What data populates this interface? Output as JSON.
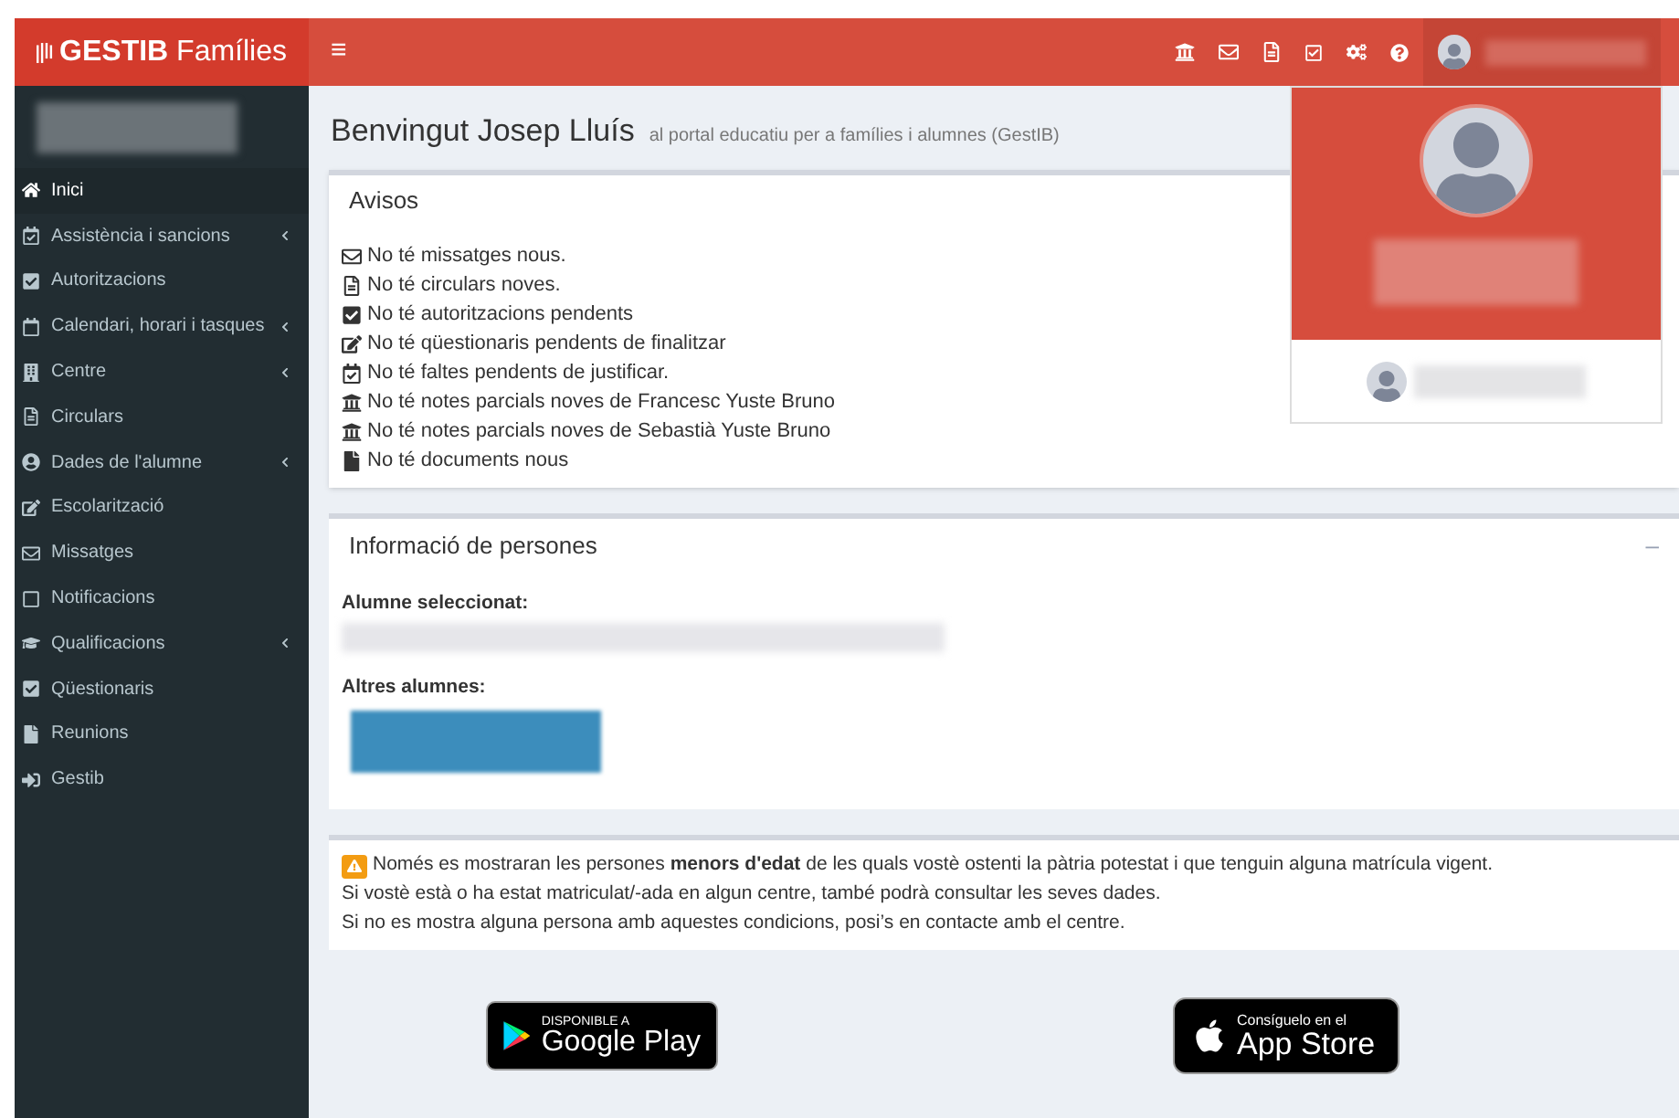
{
  "brand": {
    "bold": "GESTIB",
    "light": "Famílies"
  },
  "header": {
    "menu_toggle": "≡"
  },
  "sidebar": {
    "items": [
      {
        "label": "Inici",
        "selected": true,
        "has_submenu": false
      },
      {
        "label": "Assistència i sancions",
        "selected": false,
        "has_submenu": true
      },
      {
        "label": "Autoritzacions",
        "selected": false,
        "has_submenu": false
      },
      {
        "label": "Calendari, horari i tasques",
        "selected": false,
        "has_submenu": true
      },
      {
        "label": "Centre",
        "selected": false,
        "has_submenu": true
      },
      {
        "label": "Circulars",
        "selected": false,
        "has_submenu": false
      },
      {
        "label": "Dades de l'alumne",
        "selected": false,
        "has_submenu": true
      },
      {
        "label": "Escolarització",
        "selected": false,
        "has_submenu": false
      },
      {
        "label": "Missatges",
        "selected": false,
        "has_submenu": false
      },
      {
        "label": "Notificacions",
        "selected": false,
        "has_submenu": false
      },
      {
        "label": "Qualificacions",
        "selected": false,
        "has_submenu": true
      },
      {
        "label": "Qüestionaris",
        "selected": false,
        "has_submenu": false
      },
      {
        "label": "Reunions",
        "selected": false,
        "has_submenu": false
      },
      {
        "label": "Gestib",
        "selected": false,
        "has_submenu": false
      }
    ]
  },
  "page": {
    "title": "Benvingut Josep Lluís",
    "subtitle": "al portal educatiu per a famílies i alumnes (GestIB)"
  },
  "avisos": {
    "title": "Avisos",
    "items": [
      "No té missatges nous.",
      "No té circulars noves.",
      "No té autoritzacions pendents",
      "No té qüestionaris pendents de finalitzar",
      "No té faltes pendents de justificar.",
      "No té notes parcials noves de Francesc Yuste Bruno",
      "No té notes parcials noves de Sebastià Yuste Bruno",
      "No té documents nous"
    ]
  },
  "persones": {
    "title": "Informació de persones",
    "collapse": "–",
    "selected_label": "Alumne seleccionat:",
    "others_label": "Altres alumnes:"
  },
  "notice": {
    "lines": [
      "Només es mostraran les persones **menors d'edat** de les quals vostè ostenti la pàtria potestat i que tenguin alguna matrícula vigent.",
      "Si vostè està o ha estat matriculat/-ada en algun centre, també podrà consultar les seves dades.",
      "Si no es mostra alguna persona amb aquestes condicions, posi’s en contacte amb el centre."
    ]
  },
  "stores": {
    "google": {
      "small": "DISPONIBLE A",
      "big": "Google Play"
    },
    "apple": {
      "small": "Consíguelo en el",
      "big": "App Store"
    }
  }
}
